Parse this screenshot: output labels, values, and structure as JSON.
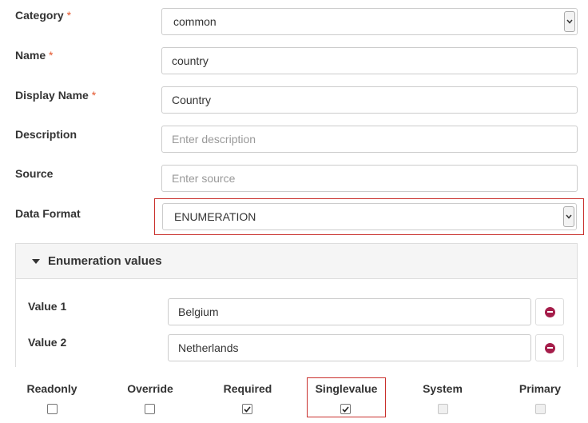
{
  "form": {
    "category": {
      "label": "Category",
      "required_mark": "*",
      "value": "common"
    },
    "name": {
      "label": "Name",
      "required_mark": "*",
      "value": "country"
    },
    "display_name": {
      "label": "Display Name",
      "required_mark": "*",
      "value": "Country"
    },
    "description": {
      "label": "Description",
      "value": "",
      "placeholder": "Enter description"
    },
    "source": {
      "label": "Source",
      "value": "",
      "placeholder": "Enter source"
    },
    "data_format": {
      "label": "Data Format",
      "value": "ENUMERATION"
    }
  },
  "enumeration": {
    "title": "Enumeration values",
    "items": [
      {
        "label": "Value 1",
        "value": "Belgium"
      },
      {
        "label": "Value 2",
        "value": "Netherlands"
      }
    ]
  },
  "flags": [
    {
      "label": "Readonly",
      "checked": false,
      "disabled": false
    },
    {
      "label": "Override",
      "checked": false,
      "disabled": false
    },
    {
      "label": "Required",
      "checked": true,
      "disabled": false
    },
    {
      "label": "Singlevalue",
      "checked": true,
      "disabled": false
    },
    {
      "label": "System",
      "checked": false,
      "disabled": true
    },
    {
      "label": "Primary",
      "checked": false,
      "disabled": true
    }
  ],
  "colors": {
    "required_mark": "#e4572e",
    "highlight_border": "#c9302c",
    "remove_icon": "#a51d4a"
  },
  "icons": {
    "select_caret": "chevron-down-icon",
    "panel_toggle": "caret-down-icon",
    "remove": "minus-circle-icon",
    "checkmark": "checkmark-icon"
  }
}
